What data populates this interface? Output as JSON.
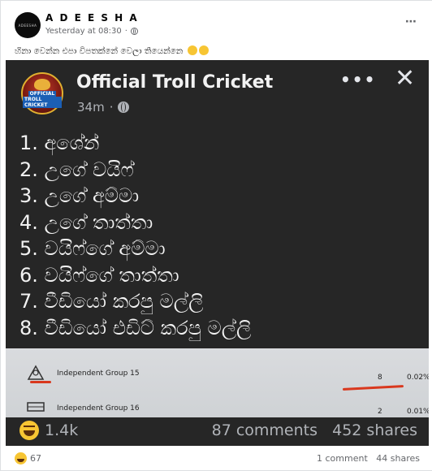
{
  "post": {
    "author": "A D E E S H A",
    "timestamp": "Yesterday at 08:30",
    "separator": "·",
    "more_icon": "⋯",
    "caption": "හිනා වෙන්න එපා විපතක්නේ වෙලා තියෙන්නෙ",
    "caption_emojis": [
      "laughing-face",
      "laughing-face"
    ]
  },
  "shared_image": {
    "page_name": "Official Troll Cricket",
    "logo_text": [
      "OFFICIAL",
      "TROLL CRICKET"
    ],
    "time": "34m",
    "separator": "·",
    "more_icon": "•••",
    "close_icon": "✕",
    "list": [
      "1. අශේන්",
      "2. උගේ වයිෆ්",
      "3. උගේ අම්මා",
      "4. උගේ තාත්තා",
      "5. වයිෆ්ගේ අම්මා",
      "6. වයිෆ්ගේ තාත්තා",
      "7. වීඩියෝ කරපු මල්ලි",
      "8. වීඩියෝ එඩිට් කරපු මල්ලි"
    ],
    "table_rows": [
      {
        "name": "Independent Group 15",
        "count": "8",
        "percent": "0.02%"
      },
      {
        "name": "Independent Group 16",
        "count": "2",
        "percent": "0.01%"
      }
    ],
    "reactions": "1.4k",
    "comments": "87 comments",
    "shares": "452 shares"
  },
  "footer": {
    "reaction_count": "67",
    "comments": "1 comment",
    "shares": "44 shares"
  },
  "colors": {
    "image_bg": "#262626",
    "accent_red": "#d9381e",
    "haha_yellow": "#f7c533"
  }
}
